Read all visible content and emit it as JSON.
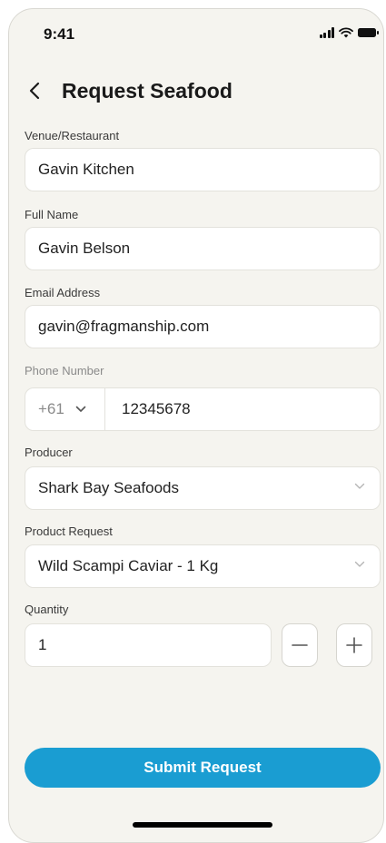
{
  "status_bar": {
    "time": "9:41"
  },
  "header": {
    "title": "Request Seafood"
  },
  "venue": {
    "label": "Venue/Restaurant",
    "value": "Gavin Kitchen"
  },
  "full_name": {
    "label": "Full Name",
    "value": "Gavin Belson"
  },
  "email": {
    "label": "Email Address",
    "value": "gavin@fragmanship.com"
  },
  "phone": {
    "label": "Phone Number",
    "country_code": "+61",
    "value": "12345678"
  },
  "producer": {
    "label": "Producer",
    "value": "Shark Bay Seafoods"
  },
  "product": {
    "label": "Product Request",
    "value": "Wild Scampi Caviar - 1 Kg"
  },
  "quantity": {
    "label": "Quantity",
    "value": "1"
  },
  "submit": {
    "label": "Submit Request"
  },
  "colors": {
    "accent": "#1a9dd2",
    "background": "#f5f4ef"
  },
  "icons": [
    "cellular-signal-icon",
    "wifi-icon",
    "battery-icon",
    "back-arrow-icon",
    "chevron-down-icon",
    "minus-icon",
    "plus-icon"
  ]
}
